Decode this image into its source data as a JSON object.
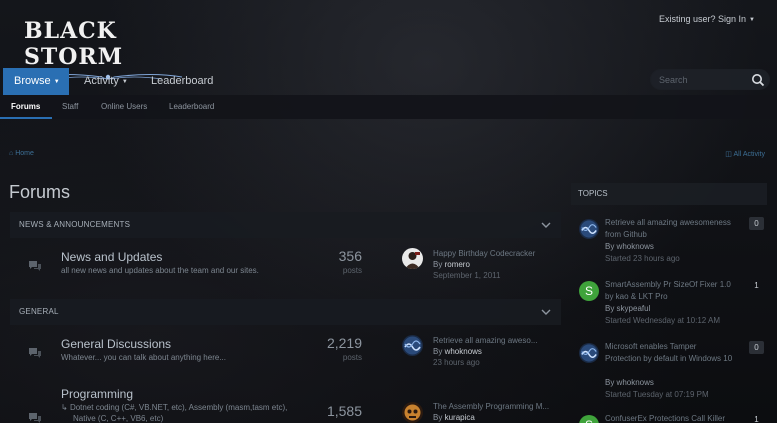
{
  "header": {
    "logo_text": "BLACK STORM",
    "signin": "Existing user? Sign In"
  },
  "nav": {
    "tabs": [
      {
        "label": "Browse",
        "active": true,
        "dropdown": true
      },
      {
        "label": "Activity",
        "active": false,
        "dropdown": true
      },
      {
        "label": "Leaderboard",
        "active": false,
        "dropdown": false
      }
    ],
    "search_placeholder": "Search"
  },
  "subnav": {
    "items": [
      {
        "label": "Forums",
        "active": true
      },
      {
        "label": "Staff",
        "active": false
      },
      {
        "label": "Online Users",
        "active": false
      },
      {
        "label": "Leaderboard",
        "active": false
      }
    ]
  },
  "breadcrumb": {
    "home": "Home"
  },
  "unread_link": "All Activity",
  "page_title": "Forums",
  "categories": [
    {
      "label": "NEWS & ANNOUNCEMENTS",
      "forums": [
        {
          "title": "News and Updates",
          "description": "all new news and updates about the team and our sites.",
          "posts": "356",
          "posts_label": "posts",
          "last_title": "Happy Birthday Codecracker",
          "last_by_prefix": "By",
          "last_by": "romero",
          "last_date": "September 1, 2011"
        }
      ]
    },
    {
      "label": "GENERAL",
      "forums": [
        {
          "title": "General Discussions",
          "description": "Whatever... you can talk about anything here...",
          "posts": "2,219",
          "posts_label": "posts",
          "last_title": "Retrieve all amazing aweso...",
          "last_by_prefix": "By",
          "last_by": "whoknows",
          "last_date": "23 hours ago"
        },
        {
          "title": "Programming",
          "sub_line_1": "Dotnet coding (C#, VB.NET, etc),   Assembly (masm,tasm etc),",
          "sub_line_2": "Native (C, C++, VB6, etc)",
          "posts": "1,585",
          "last_title": "The Assembly Programming M...",
          "last_by_prefix": "By",
          "last_by": "kurapica"
        }
      ]
    }
  ],
  "sidebar": {
    "title": "TOPICS",
    "topics": [
      {
        "title": "Retrieve all amazing awesomeness from Github",
        "by": "By whoknows",
        "meta": "Started 23 hours ago",
        "count": "0"
      },
      {
        "title": "SmartAssembly Pr SizeOf Fixer 1.0 by kao & LKT Pro",
        "by": "By skypeaful",
        "meta": "Started Wednesday at 10:12 AM",
        "count": "1",
        "avatar_letter": "S"
      },
      {
        "title": "Microsoft enables Tamper Protection by default in Windows 10",
        "by": "By whoknows",
        "meta": "Started Tuesday at 07:19 PM",
        "count": "0"
      },
      {
        "title": "ConfuserEx Protections Call Killer",
        "count": "1",
        "avatar_letter": "S"
      }
    ]
  },
  "colors": {
    "accent": "#2a6fb3",
    "background": "#0d0f13",
    "avatar_green": "#3fa33b"
  }
}
